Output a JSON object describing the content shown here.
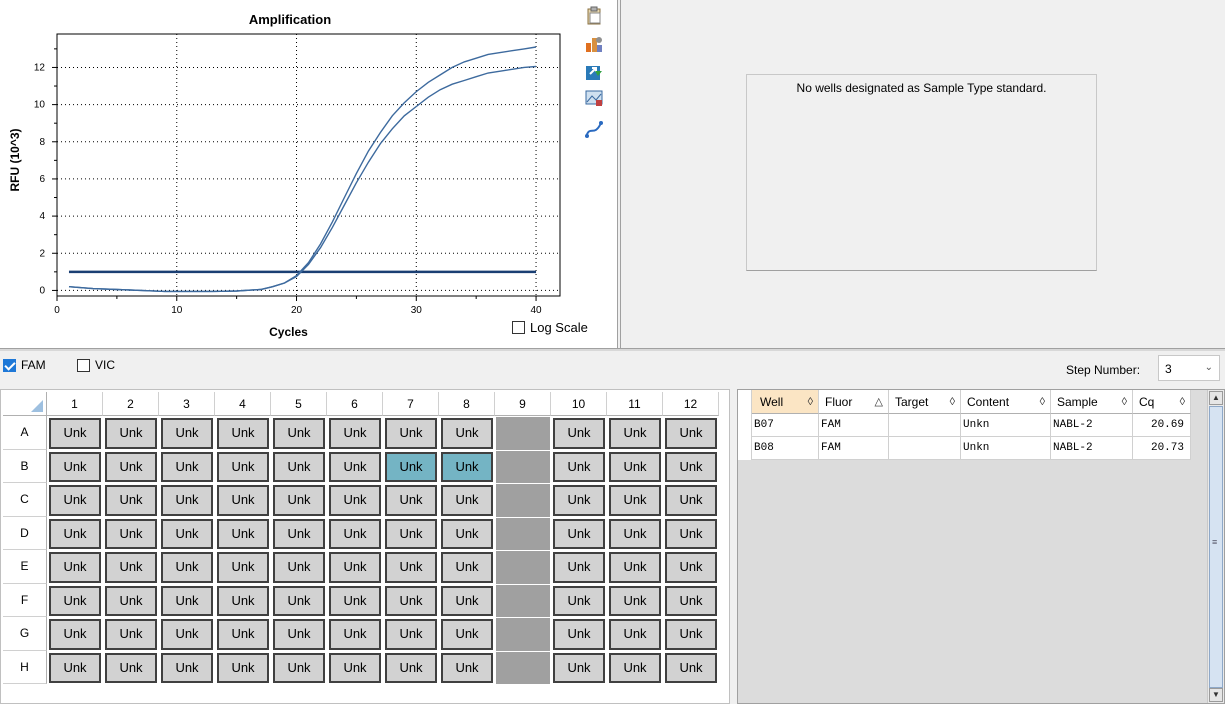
{
  "chart": {
    "title": "Amplification",
    "log_scale_label": "Log Scale",
    "log_scale_checked": false,
    "tools": [
      "clipboard-icon",
      "chart-settings-icon",
      "export-icon",
      "image-icon",
      "curve-icon"
    ]
  },
  "chart_data": {
    "type": "line",
    "title": "Amplification",
    "xlabel": "Cycles",
    "ylabel": "RFU (10^3)",
    "xlim": [
      0,
      42
    ],
    "ylim": [
      -0.3,
      13.8
    ],
    "xticks": [
      0,
      10,
      20,
      30,
      40
    ],
    "yticks": [
      0,
      2,
      4,
      6,
      8,
      10,
      12
    ],
    "grid": true,
    "threshold": 1.0,
    "series": [
      {
        "x": [
          1,
          3,
          5,
          7,
          9,
          11,
          13,
          15,
          17,
          18,
          19,
          20,
          21,
          22,
          23,
          24,
          25,
          26,
          27,
          28,
          29,
          30,
          31,
          32,
          33,
          34,
          35,
          36,
          37,
          38,
          39,
          40
        ],
        "values": [
          0.2,
          0.1,
          0.05,
          0.0,
          -0.05,
          -0.05,
          -0.05,
          -0.03,
          0.05,
          0.2,
          0.4,
          0.8,
          1.5,
          2.5,
          3.7,
          5.0,
          6.3,
          7.5,
          8.5,
          9.4,
          10.1,
          10.7,
          11.2,
          11.6,
          12.0,
          12.3,
          12.5,
          12.7,
          12.8,
          12.9,
          13.0,
          13.1
        ],
        "color": "#3d6a9e"
      },
      {
        "x": [
          1,
          3,
          5,
          7,
          9,
          11,
          13,
          15,
          17,
          18,
          19,
          20,
          21,
          22,
          23,
          24,
          25,
          26,
          27,
          28,
          29,
          30,
          31,
          32,
          33,
          34,
          35,
          36,
          37,
          38,
          39,
          40
        ],
        "values": [
          0.2,
          0.1,
          0.05,
          0.0,
          -0.05,
          -0.05,
          -0.05,
          -0.03,
          0.05,
          0.2,
          0.4,
          0.75,
          1.4,
          2.3,
          3.4,
          4.6,
          5.8,
          6.9,
          7.9,
          8.7,
          9.4,
          9.9,
          10.4,
          10.8,
          11.1,
          11.3,
          11.5,
          11.7,
          11.8,
          11.9,
          12.0,
          12.05
        ],
        "color": "#3d6a9e"
      }
    ]
  },
  "standard_curve": {
    "message": "No wells designated as Sample Type standard."
  },
  "controls": {
    "fluors": [
      {
        "label": "FAM",
        "checked": true
      },
      {
        "label": "VIC",
        "checked": false
      }
    ],
    "step_label": "Step Number:",
    "step_value": "3"
  },
  "plate": {
    "columns": [
      "1",
      "2",
      "3",
      "4",
      "5",
      "6",
      "7",
      "8",
      "9",
      "10",
      "11",
      "12"
    ],
    "rows": [
      "A",
      "B",
      "C",
      "D",
      "E",
      "F",
      "G",
      "H"
    ],
    "well_label": "Unk",
    "empty_column": "9",
    "selected_wells": [
      "B7",
      "B8"
    ]
  },
  "results": {
    "columns": [
      {
        "label": "Well",
        "sort": "◊"
      },
      {
        "label": "Fluor",
        "sort": "△"
      },
      {
        "label": "Target",
        "sort": "◊"
      },
      {
        "label": "Content",
        "sort": "◊"
      },
      {
        "label": "Sample",
        "sort": "◊"
      },
      {
        "label": "Cq",
        "sort": "◊"
      }
    ],
    "rows": [
      [
        "B07",
        "FAM",
        "",
        "Unkn",
        "NABL-2",
        "20.69"
      ],
      [
        "B08",
        "FAM",
        "",
        "Unkn",
        "NABL-2",
        "20.73"
      ]
    ]
  }
}
